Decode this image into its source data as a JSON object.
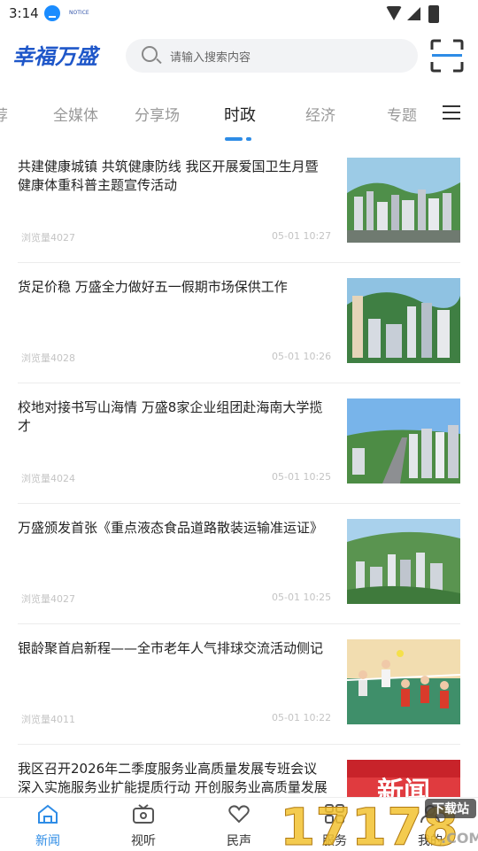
{
  "status_bar": {
    "time": "3:14",
    "tiny_text": "NOTICE"
  },
  "header": {
    "logo_text": "幸福万盛"
  },
  "search": {
    "placeholder": "请输入搜索内容"
  },
  "tabs": [
    {
      "label": "荐"
    },
    {
      "label": "全媒体"
    },
    {
      "label": "分享场"
    },
    {
      "label": "时政"
    },
    {
      "label": "经济"
    },
    {
      "label": "专题"
    }
  ],
  "active_tab": "时政",
  "news": [
    {
      "title": "共建健康城镇 共筑健康防线 我区开展爱国卫生月暨健康体重科普主题宣传活动",
      "views": "浏览量4027",
      "date": "05-01 10:27",
      "thumb": "city-aerial-photo"
    },
    {
      "title": "货足价稳 万盛全力做好五一假期市场保供工作",
      "views": "浏览量4028",
      "date": "05-01 10:26",
      "thumb": "city-mountain-photo"
    },
    {
      "title": "校地对接书写山海情 万盛8家企业组团赴海南大学揽才",
      "views": "浏览量4024",
      "date": "05-01 10:25",
      "thumb": "city-road-photo"
    },
    {
      "title": "万盛颁发首张《重点液态食品道路散装运输准运证》",
      "views": "浏览量4027",
      "date": "05-01 10:25",
      "thumb": "city-hills-photo"
    },
    {
      "title": "银龄聚首启新程——全市老年人气排球交流活动侧记",
      "views": "浏览量4011",
      "date": "05-01 10:22",
      "thumb": "volleyball-photo"
    },
    {
      "title": "我区召开2026年二季度服务业高质量发展专班会议 深入实施服务业扩能提质行动 开创服务业高质量发展新",
      "views": "",
      "date": "",
      "thumb": "news-banner-red"
    }
  ],
  "news_banner_text": "新闻",
  "bottom_nav": [
    {
      "label": "新闻",
      "icon": "home-icon"
    },
    {
      "label": "视听",
      "icon": "tv-icon"
    },
    {
      "label": "民声",
      "icon": "heart-icon"
    },
    {
      "label": "服务",
      "icon": "grid-icon"
    },
    {
      "label": "我的",
      "icon": "user-icon"
    }
  ],
  "watermark": {
    "text": "17178",
    "sub": "下载站",
    "suffix": ".COM"
  },
  "colors": {
    "accent": "#2e8ce6",
    "logo": "#1f57c9"
  }
}
